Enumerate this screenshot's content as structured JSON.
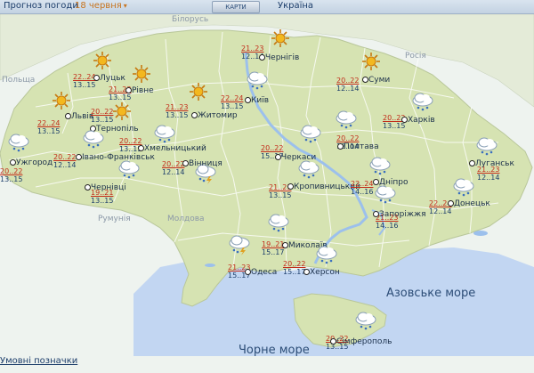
{
  "header": {
    "title": "Прогноз погоди",
    "date": "18 червня",
    "maps_button": "КАРТИ",
    "region": "Україна"
  },
  "neighbors": {
    "belarus": "Білорусь",
    "russia": "Росія",
    "poland": "Польща",
    "romania": "Румунія",
    "moldova": "Молдова"
  },
  "seas": {
    "azov": "Азовське море",
    "black": "Чорне море"
  },
  "legend_link": "Умовні позначки",
  "colors": {
    "land": "#d6e3b2",
    "water": "#c2d6f2",
    "day_temp": "#c22c1a",
    "night_temp": "#1d3e6b"
  },
  "cities": [
    {
      "name": "Луцьк",
      "day": "22..24",
      "night": "13..15",
      "icon": "sun-icon"
    },
    {
      "name": "Рівне",
      "day": "21..23",
      "night": "13..15",
      "icon": "sun-icon"
    },
    {
      "name": "Львів",
      "day": "22..24",
      "night": "13..15",
      "icon": "sun-icon"
    },
    {
      "name": "Тернопіль",
      "day": "20..22",
      "night": "13..15",
      "icon": "sun-icon"
    },
    {
      "name": "Житомир",
      "day": "21..23",
      "night": "13..15",
      "icon": "sun-icon"
    },
    {
      "name": "Київ",
      "day": "22..24",
      "night": "13..15",
      "icon": "rain-cloud-icon"
    },
    {
      "name": "Чернігів",
      "day": "21..23",
      "night": "12..14",
      "icon": "sun-icon"
    },
    {
      "name": "Суми",
      "day": "20..22",
      "night": "12..14",
      "icon": "sun-icon"
    },
    {
      "name": "Харків",
      "day": "20..22",
      "night": "13..15",
      "icon": "rain-cloud-icon"
    },
    {
      "name": "Полтава",
      "day": "20..22",
      "night": "12..14",
      "icon": "rain-cloud-icon"
    },
    {
      "name": "Луганськ",
      "day": "21..23",
      "night": "12..14",
      "icon": "rain-cloud-icon"
    },
    {
      "name": "Ужгород",
      "day": "20..22",
      "night": "13..15",
      "icon": "rain-cloud-icon"
    },
    {
      "name": "Івано-Франківськ",
      "day": "20..22",
      "night": "12..14",
      "icon": "rain-cloud-icon"
    },
    {
      "name": "Хмельницький",
      "day": "20..22",
      "night": "13..15",
      "icon": "rain-cloud-icon"
    },
    {
      "name": "Вінниця",
      "day": "20..22",
      "night": "12..14",
      "icon": "storm-cloud-icon"
    },
    {
      "name": "Чернівці",
      "day": "19..21",
      "night": "13..15",
      "icon": "rain-cloud-icon"
    },
    {
      "name": "Черкаси",
      "day": "20..22",
      "night": "15..17",
      "icon": "rain-cloud-icon"
    },
    {
      "name": "Кропивницький",
      "day": "21..23",
      "night": "13..15",
      "icon": "rain-cloud-icon"
    },
    {
      "name": "Дніпро",
      "day": "22..24",
      "night": "14..16",
      "icon": "rain-cloud-icon"
    },
    {
      "name": "Донецьк",
      "day": "22..24",
      "night": "12..14",
      "icon": "rain-cloud-icon"
    },
    {
      "name": "Запоріжжя",
      "day": "21..23",
      "night": "14..16",
      "icon": "rain-cloud-icon"
    },
    {
      "name": "Миколаїв",
      "day": "19..21",
      "night": "15..17",
      "icon": "rain-cloud-icon"
    },
    {
      "name": "Одеса",
      "day": "21..23",
      "night": "15..17",
      "icon": "storm-cloud-icon"
    },
    {
      "name": "Херсон",
      "day": "20..22",
      "night": "15..17",
      "icon": "rain-cloud-icon"
    },
    {
      "name": "Сімферополь",
      "day": "20..22",
      "night": "13..15",
      "icon": "rain-cloud-icon"
    }
  ]
}
